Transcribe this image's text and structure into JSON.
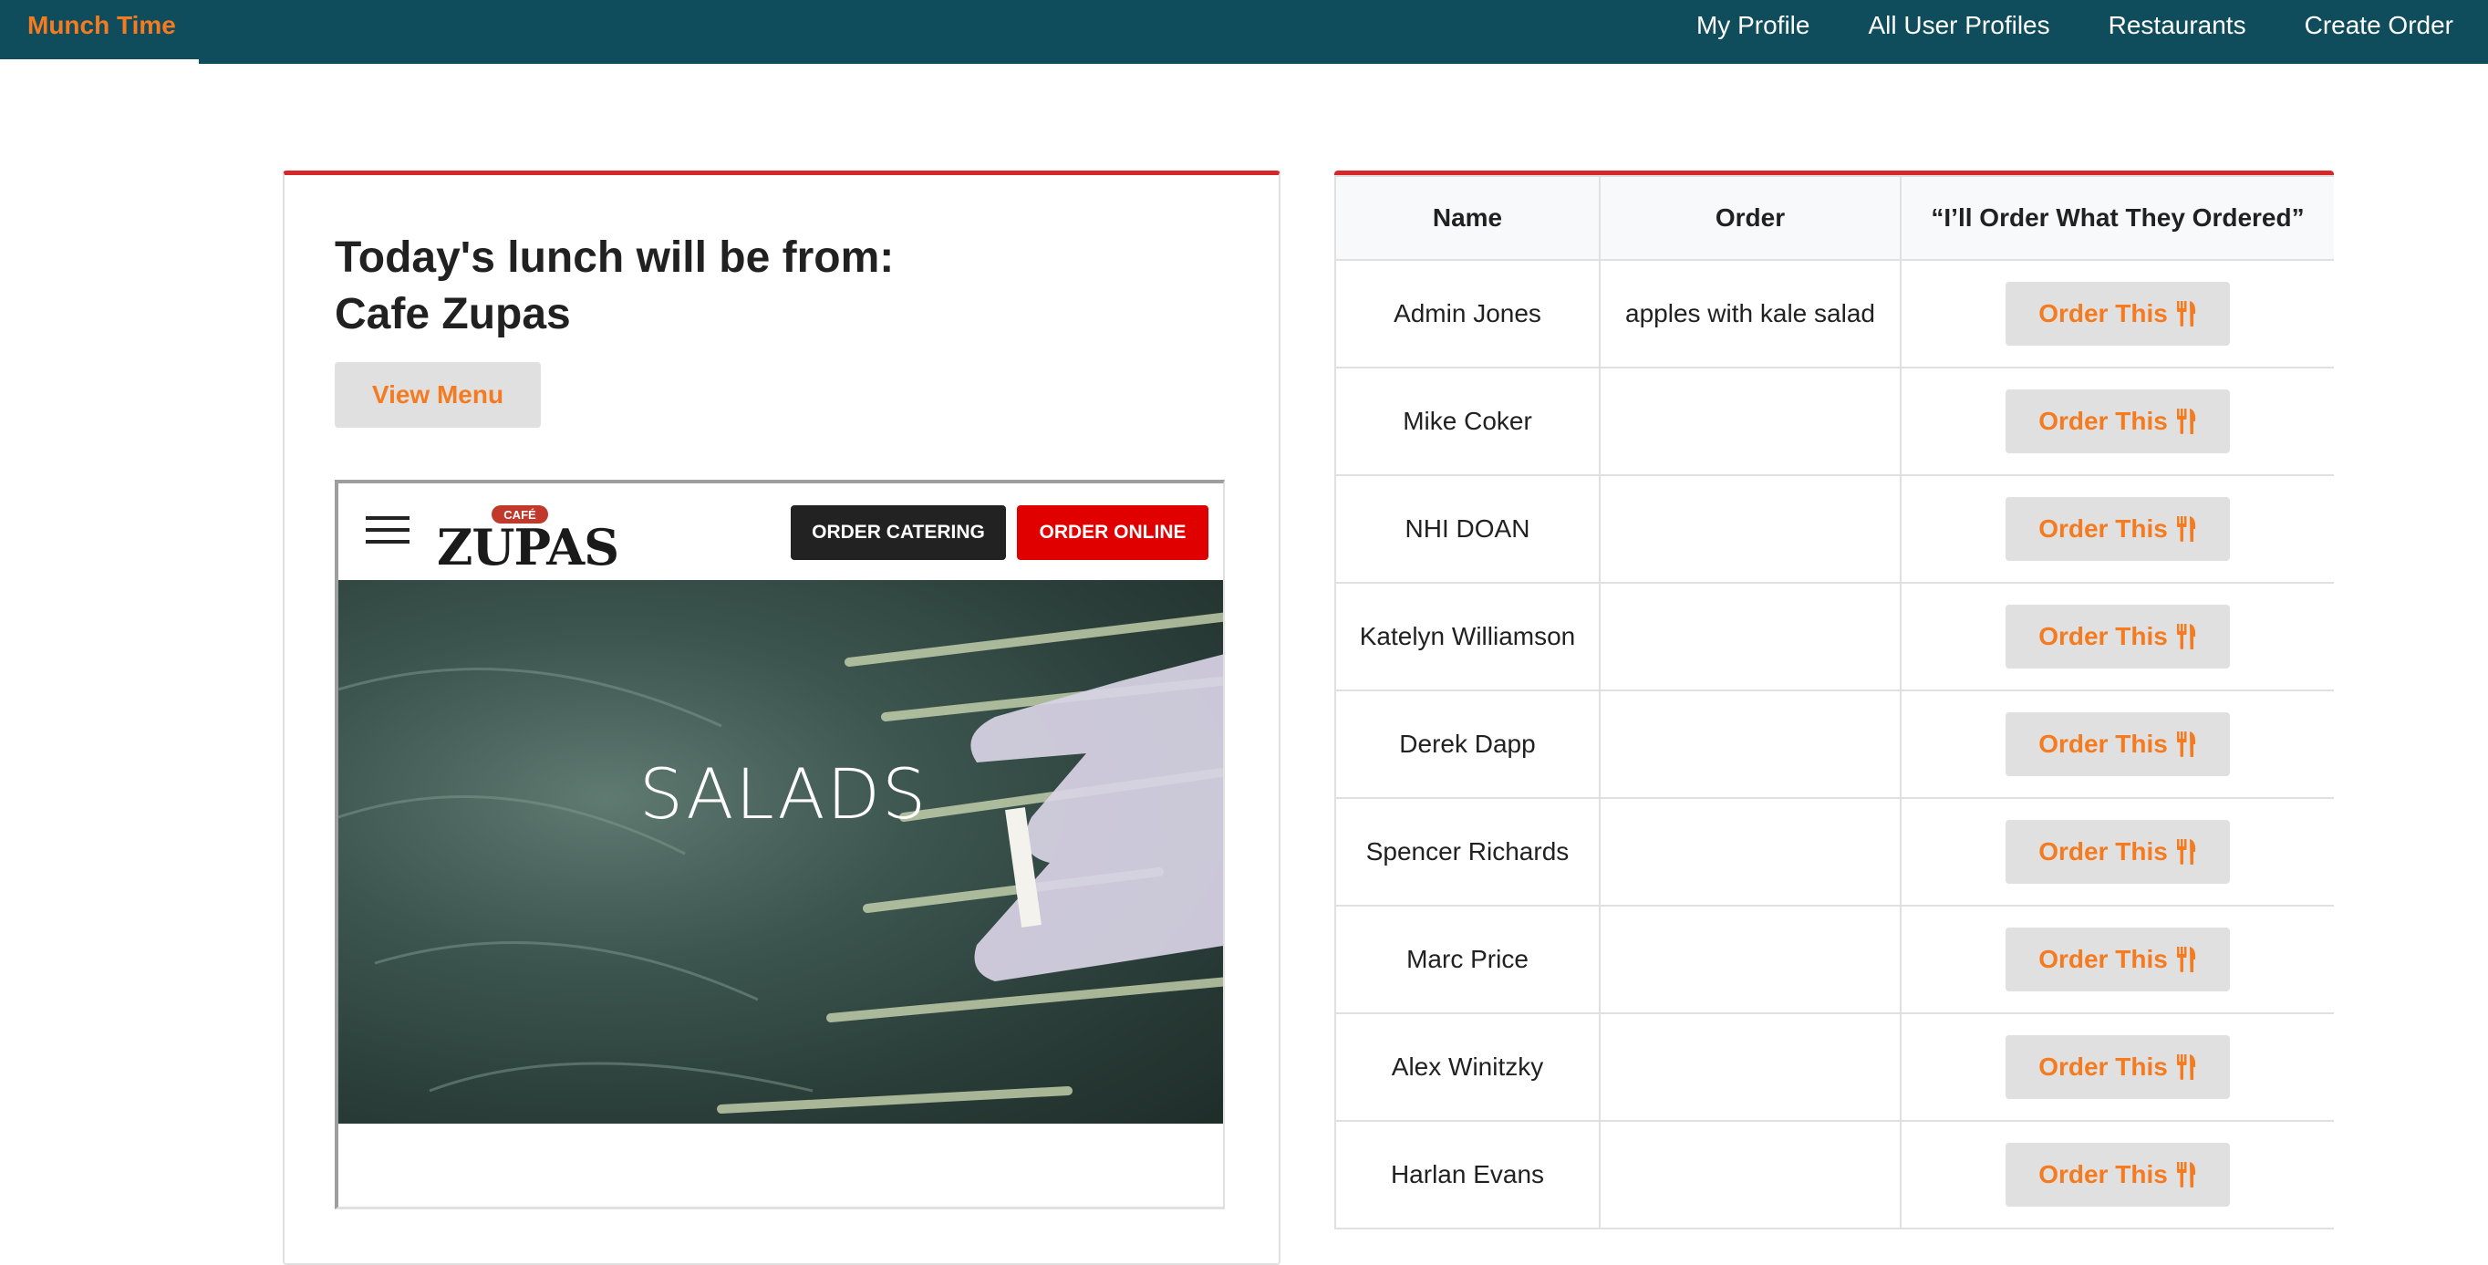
{
  "navbar": {
    "brand": "Munch Time",
    "links": [
      "My Profile",
      "All User Profiles",
      "Restaurants",
      "Create Order"
    ]
  },
  "lunch": {
    "heading_line1": "Today's lunch will be from:",
    "heading_line2": "Cafe Zupas",
    "view_menu_label": "View Menu"
  },
  "preview": {
    "logo_small": "CAFÉ",
    "logo_main": "ZUPAS",
    "catering_label": "ORDER CATERING",
    "online_label": "ORDER ONLINE",
    "hero_label": "SALADS"
  },
  "orders_table": {
    "headers": [
      "Name",
      "Order",
      "“I’ll Order What They Ordered”"
    ],
    "button_label": "Order This",
    "rows": [
      {
        "name": "Admin Jones",
        "order": "apples with kale salad"
      },
      {
        "name": "Mike Coker",
        "order": ""
      },
      {
        "name": "NHI DOAN",
        "order": ""
      },
      {
        "name": "Katelyn Williamson",
        "order": ""
      },
      {
        "name": "Derek Dapp",
        "order": ""
      },
      {
        "name": "Spencer Richards",
        "order": ""
      },
      {
        "name": "Marc Price",
        "order": ""
      },
      {
        "name": "Alex Winitzky",
        "order": ""
      },
      {
        "name": "Harlan Evans",
        "order": ""
      }
    ]
  },
  "colors": {
    "navbar": "#0f4c5c",
    "accent": "#f47b20",
    "card_border": "#d62828"
  }
}
